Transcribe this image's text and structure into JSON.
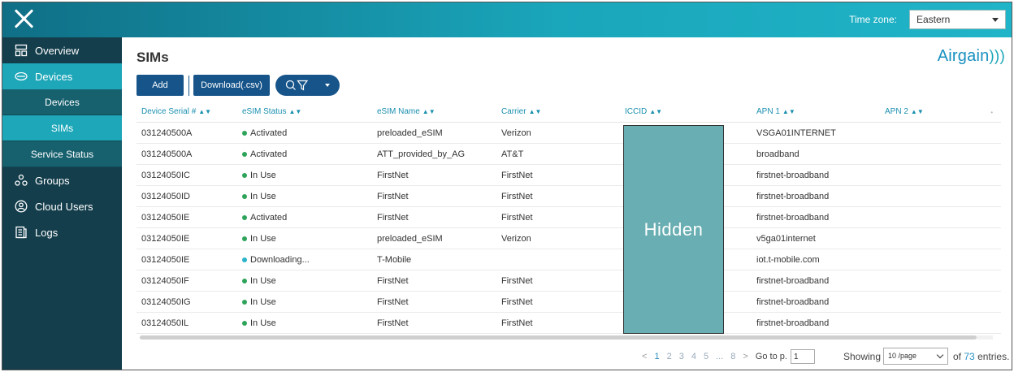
{
  "topbar": {
    "timezone_label": "Time zone:",
    "timezone_value": "Eastern"
  },
  "sidebar": {
    "items": [
      {
        "label": "Overview",
        "icon": "overview-icon"
      },
      {
        "label": "Devices",
        "icon": "devices-icon"
      },
      {
        "label": "Devices"
      },
      {
        "label": "SIMs"
      },
      {
        "label": "Service Status"
      },
      {
        "label": "Groups",
        "icon": "groups-icon"
      },
      {
        "label": "Cloud Users",
        "icon": "cloud-users-icon"
      },
      {
        "label": "Logs",
        "icon": "logs-icon"
      }
    ]
  },
  "main": {
    "title": "SIMs",
    "brand": "Airgain",
    "brand_waves": ")))",
    "buttons": {
      "add": "Add",
      "download": "Download(.csv)"
    },
    "columns": [
      "Device Serial #",
      "eSIM Status",
      "eSIM Name",
      "Carrier",
      "ICCID",
      "APN 1",
      "APN 2"
    ],
    "rows": [
      {
        "serial": "031240500A",
        "status": "Activated",
        "name": "preloaded_eSIM",
        "carrier": "Verizon",
        "apn1": "VSGA01INTERNET"
      },
      {
        "serial": "031240500A",
        "status": "Activated",
        "name": "ATT_provided_by_AG",
        "carrier": "AT&T",
        "apn1": "broadband"
      },
      {
        "serial": "03124050IC",
        "status": "In Use",
        "name": "FirstNet",
        "carrier": "FirstNet",
        "apn1": "firstnet-broadband"
      },
      {
        "serial": "03124050ID",
        "status": "In Use",
        "name": "FirstNet",
        "carrier": "FirstNet",
        "apn1": "firstnet-broadband"
      },
      {
        "serial": "03124050IE",
        "status": "Activated",
        "name": "FirstNet",
        "carrier": "FirstNet",
        "apn1": "firstnet-broadband"
      },
      {
        "serial": "03124050IE",
        "status": "In Use",
        "name": "preloaded_eSIM",
        "carrier": "Verizon",
        "apn1": "v5ga01internet"
      },
      {
        "serial": "03124050IE",
        "status": "Downloading...",
        "name": "T-Mobile",
        "carrier": "",
        "apn1": "iot.t-mobile.com"
      },
      {
        "serial": "03124050IF",
        "status": "In Use",
        "name": "FirstNet",
        "carrier": "FirstNet",
        "apn1": "firstnet-broadband"
      },
      {
        "serial": "03124050IG",
        "status": "In Use",
        "name": "FirstNet",
        "carrier": "FirstNet",
        "apn1": "firstnet-broadband"
      },
      {
        "serial": "03124050IL",
        "status": "In Use",
        "name": "FirstNet",
        "carrier": "FirstNet",
        "apn1": "firstnet-broadband"
      }
    ],
    "hidden_label": "Hidden"
  },
  "pagination": {
    "prev": "<",
    "pages": [
      "1",
      "2",
      "3",
      "4",
      "5"
    ],
    "ellipsis": "...",
    "last": "8",
    "next": ">",
    "goto_label": "Go to p.",
    "goto_value": "1",
    "showing_label": "Showing",
    "page_size": "10 /page",
    "of_label": "of",
    "total": "73",
    "entries_label": "entries."
  },
  "colors": {
    "accent": "#1da7b9",
    "sidebar": "#143e4c",
    "button": "#16548a",
    "active_dot": "#2ea35a",
    "downloading_dot": "#2bb3c9"
  }
}
